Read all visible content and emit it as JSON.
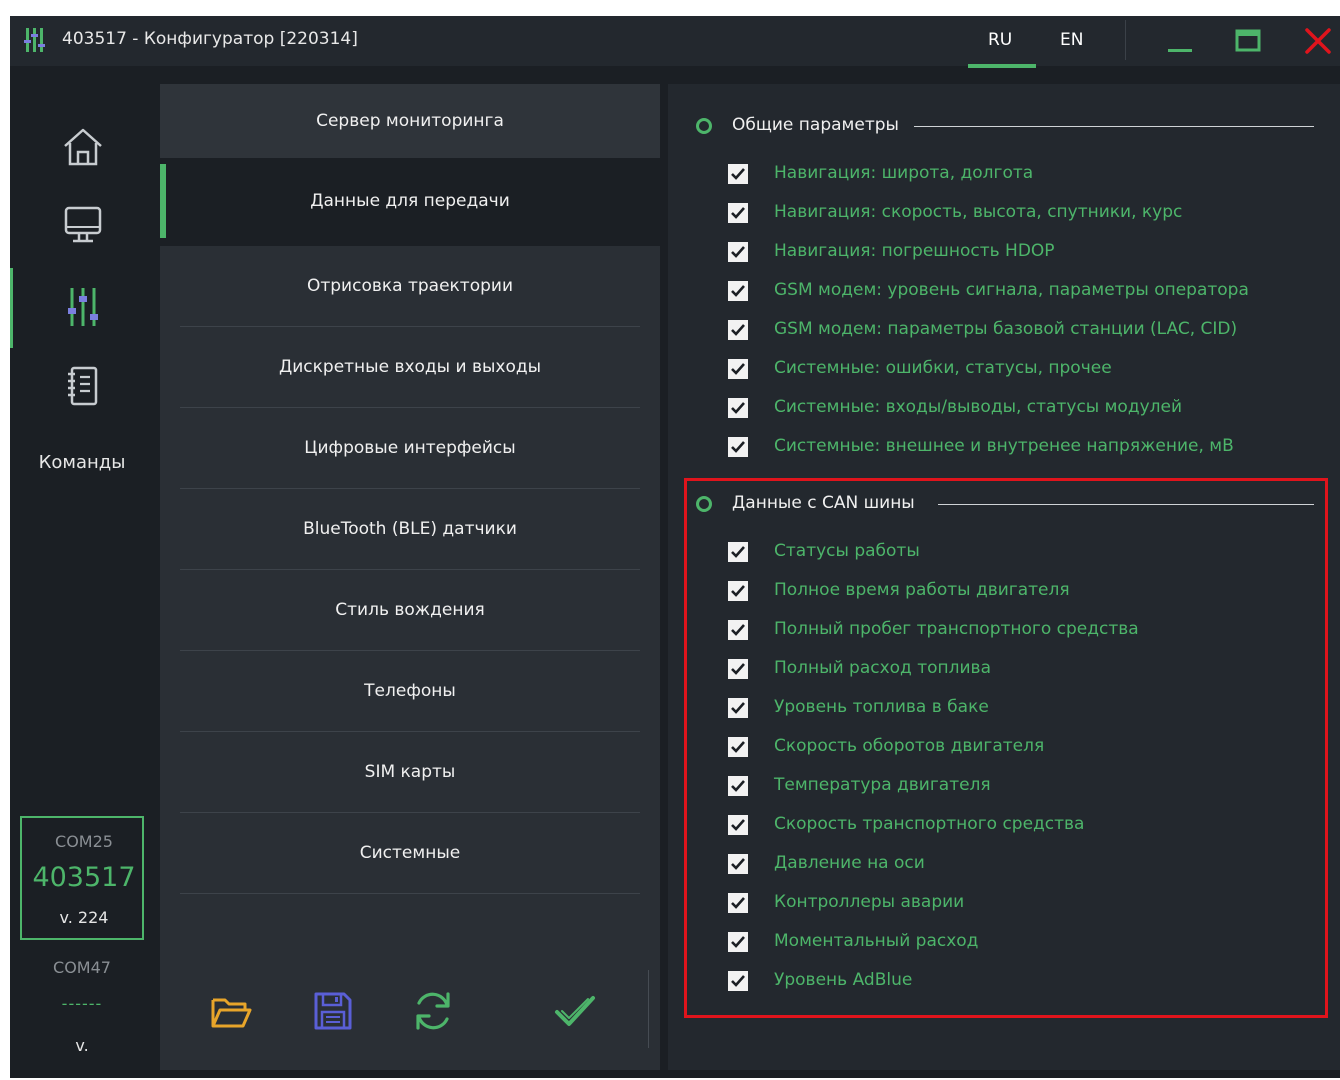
{
  "window": {
    "title": "403517 - Конфигуратор [220314]"
  },
  "languages": [
    "RU",
    "EN"
  ],
  "active_language": "RU",
  "sidebar": {
    "commands_label": "Команды",
    "device": {
      "port": "COM25",
      "id": "403517",
      "version": "v. 224"
    },
    "device2": {
      "port": "COM47",
      "id": "------",
      "version": "v."
    }
  },
  "menu": {
    "items": [
      {
        "label": "Сервер мониторинга"
      },
      {
        "label": "Данные для передачи"
      },
      {
        "label": "Отрисовка траектории"
      },
      {
        "label": "Дискретные входы и выходы"
      },
      {
        "label": "Цифровые интерфейсы"
      },
      {
        "label": "BlueTooth (BLE) датчики"
      },
      {
        "label": "Стиль вождения"
      },
      {
        "label": "Телефоны"
      },
      {
        "label": "SIM карты"
      },
      {
        "label": "Системные"
      }
    ],
    "active_index": 1
  },
  "sections": [
    {
      "title": "Общие параметры",
      "items": [
        {
          "label": "Навигация: широта, долгота",
          "checked": true
        },
        {
          "label": "Навигация: скорость, высота, спутники, курс",
          "checked": true
        },
        {
          "label": "Навигация: погрешность HDOP",
          "checked": true
        },
        {
          "label": "GSM модем: уровень сигнала, параметры оператора",
          "checked": true
        },
        {
          "label": "GSM модем: параметры базовой станции (LAC, CID)",
          "checked": true
        },
        {
          "label": "Системные: ошибки, статусы, прочее",
          "checked": true
        },
        {
          "label": "Системные: входы/выводы, статусы модулей",
          "checked": true
        },
        {
          "label": "Системные: внешнее и внутренее напряжение, мВ",
          "checked": true
        }
      ]
    },
    {
      "title": "Данные с CAN шины",
      "items": [
        {
          "label": "Статусы работы",
          "checked": true
        },
        {
          "label": "Полное время работы двигателя",
          "checked": true
        },
        {
          "label": "Полный пробег транспортного средства",
          "checked": true
        },
        {
          "label": "Полный расход топлива",
          "checked": true
        },
        {
          "label": "Уровень топлива в баке",
          "checked": true
        },
        {
          "label": "Скорость оборотов двигателя",
          "checked": true
        },
        {
          "label": "Температура двигателя",
          "checked": true
        },
        {
          "label": "Скорость транспортного средства",
          "checked": true
        },
        {
          "label": "Давление на оси",
          "checked": true
        },
        {
          "label": "Контроллеры аварии",
          "checked": true
        },
        {
          "label": "Моментальный расход",
          "checked": true
        },
        {
          "label": "Уровень AdBlue",
          "checked": true
        }
      ]
    }
  ],
  "icons": {
    "toolbar": [
      "folder-open-icon",
      "save-icon",
      "refresh-icon",
      "apply-check-icon"
    ],
    "sidebar": [
      "home-icon",
      "monitor-icon",
      "sliders-icon",
      "notebook-icon"
    ]
  },
  "colors": {
    "accent": "#4db56a",
    "background": "#1b1f24",
    "panel": "#23282e",
    "menu_bg": "#2a2f35",
    "highlight_border": "#e0141c",
    "close": "#e0141c",
    "folder": "#e8a52a",
    "save": "#5a5fd6"
  }
}
